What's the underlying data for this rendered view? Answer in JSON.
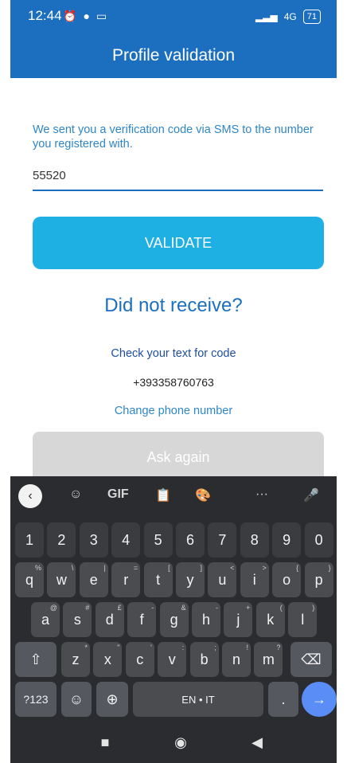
{
  "status_bar": {
    "time": "12:44",
    "left_icons": [
      "alarm-icon",
      "chat-bubble-icon",
      "tablet-icon"
    ],
    "right_icons": [
      "signal-icon",
      "4g-icon",
      "battery-icon"
    ],
    "battery_level": "71"
  },
  "app_bar": {
    "title": "Profile validation"
  },
  "form": {
    "message": "We sent you a verification code via SMS to the number you registered with.",
    "code_value": "55520",
    "validate_label": "VALIDATE",
    "not_received": "Did not receive?",
    "check_text": "Check your text for code",
    "phone_number": "+393358760763",
    "change_phone": "Change phone number",
    "ask_again": "Ask again"
  },
  "keyboard": {
    "toolbar": [
      "chevron-left-icon",
      "sticker-icon",
      "GIF",
      "clipboard-icon",
      "palette-icon",
      "more-icon",
      "microphone-icon"
    ],
    "gif_label": "GIF",
    "more_label": "···",
    "row1": [
      "1",
      "2",
      "3",
      "4",
      "5",
      "6",
      "7",
      "8",
      "9",
      "0"
    ],
    "row2": [
      {
        "k": "q",
        "h": "%"
      },
      {
        "k": "w",
        "h": "\\"
      },
      {
        "k": "e",
        "h": "|"
      },
      {
        "k": "r",
        "h": "="
      },
      {
        "k": "t",
        "h": "["
      },
      {
        "k": "y",
        "h": "]"
      },
      {
        "k": "u",
        "h": "<"
      },
      {
        "k": "i",
        "h": ">"
      },
      {
        "k": "o",
        "h": "{"
      },
      {
        "k": "p",
        "h": "}"
      }
    ],
    "row3": [
      {
        "k": "a",
        "h": "@"
      },
      {
        "k": "s",
        "h": "#"
      },
      {
        "k": "d",
        "h": "£"
      },
      {
        "k": "f",
        "h": "-"
      },
      {
        "k": "g",
        "h": "&"
      },
      {
        "k": "h",
        "h": "-"
      },
      {
        "k": "j",
        "h": "+"
      },
      {
        "k": "k",
        "h": "("
      },
      {
        "k": "l",
        "h": ")"
      }
    ],
    "row4": [
      {
        "k": "z",
        "h": "*"
      },
      {
        "k": "x",
        "h": "\""
      },
      {
        "k": "c",
        "h": "'"
      },
      {
        "k": "v",
        "h": ":"
      },
      {
        "k": "b",
        "h": ";"
      },
      {
        "k": "n",
        "h": "!"
      },
      {
        "k": "m",
        "h": "?"
      }
    ],
    "shift_label": "⇧",
    "backspace_label": "⌫",
    "symbols_label": "?123",
    "emoji_label": "☺",
    "comma_label": ",",
    "globe_label": "⊕",
    "space_label": "EN • IT",
    "period_label": ".",
    "enter_label": "→"
  },
  "nav": {
    "recents": "■",
    "home": "◉",
    "back": "◀"
  },
  "colors": {
    "primary": "#1c6fbf",
    "accent": "#1fb0e3",
    "disabled": "#d7d7d7",
    "keyboard_bg": "#2b2c30"
  }
}
